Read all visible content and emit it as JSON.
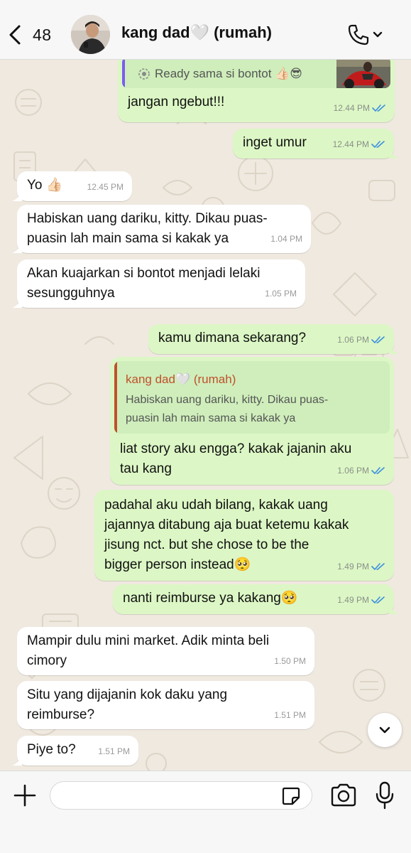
{
  "header": {
    "back_count": "48",
    "contact_name": "kang dad🤍 (rumah)"
  },
  "messages": [
    {
      "id": "m0",
      "direction": "out",
      "quote_text": "Ready sama si bontot 👍🏻😎",
      "text": "jangan ngebut!!!",
      "time": "12.44 PM",
      "read": true
    },
    {
      "id": "m1",
      "direction": "out",
      "text": "inget umur",
      "time": "12.44 PM",
      "read": true
    },
    {
      "id": "m2",
      "direction": "in",
      "text": "Yo 👍🏻",
      "time": "12.45 PM"
    },
    {
      "id": "m3",
      "direction": "in",
      "text": "Habiskan uang dariku, kitty. Dikau puas-\npuasin lah main sama si kakak ya",
      "time": "1.04 PM"
    },
    {
      "id": "m4",
      "direction": "in",
      "text": "Akan kuajarkan si bontot menjadi lelaki\nsesungguhnya",
      "time": "1.05 PM"
    },
    {
      "id": "m5",
      "direction": "out",
      "text": "kamu dimana sekarang?",
      "time": "1.06 PM",
      "read": true
    },
    {
      "id": "m6",
      "direction": "out",
      "quote_author": "kang dad🤍 (rumah)",
      "quote_text": "Habiskan uang dariku, kitty. Dikau puas-\npuasin lah main sama si kakak ya",
      "text": "liat story aku engga? kakak jajanin aku\ntau kang",
      "time": "1.06 PM",
      "read": true
    },
    {
      "id": "m7",
      "direction": "out",
      "text": "padahal aku udah bilang, kakak uang\njajannya ditabung aja buat ketemu kakak\njisung nct. but she chose to be the\nbigger person instead🥺",
      "time": "1.49 PM",
      "read": true
    },
    {
      "id": "m8",
      "direction": "out",
      "text": "nanti reimburse ya kakang🥺",
      "time": "1.49 PM",
      "read": true
    },
    {
      "id": "m9",
      "direction": "in",
      "text": "Mampir dulu mini market. Adik minta beli\ncimory",
      "time": "1.50 PM"
    },
    {
      "id": "m10",
      "direction": "in",
      "text": "Situ yang dijajanin kok daku yang\nreimburse?",
      "time": "1.51 PM"
    },
    {
      "id": "m11",
      "direction": "in",
      "text": "Piye to?",
      "time": "1.51 PM"
    }
  ],
  "composer": {
    "value": "",
    "placeholder": ""
  },
  "icons": {
    "back": "chevron-left-icon",
    "call": "phone-icon",
    "scroll_down": "chevron-down-icon",
    "attach": "plus-icon",
    "sticker": "sticker-icon",
    "camera": "camera-icon",
    "mic": "microphone-icon"
  },
  "colors": {
    "outgoing_bubble": "#dcf7c5",
    "incoming_bubble": "#ffffff",
    "chat_background": "#efe9e0",
    "read_ticks": "#3d8fe0",
    "quote_bar_self": "#7a5cf0",
    "quote_bar_contact": "#c0502c",
    "quote_author_color": "#c0502c"
  }
}
